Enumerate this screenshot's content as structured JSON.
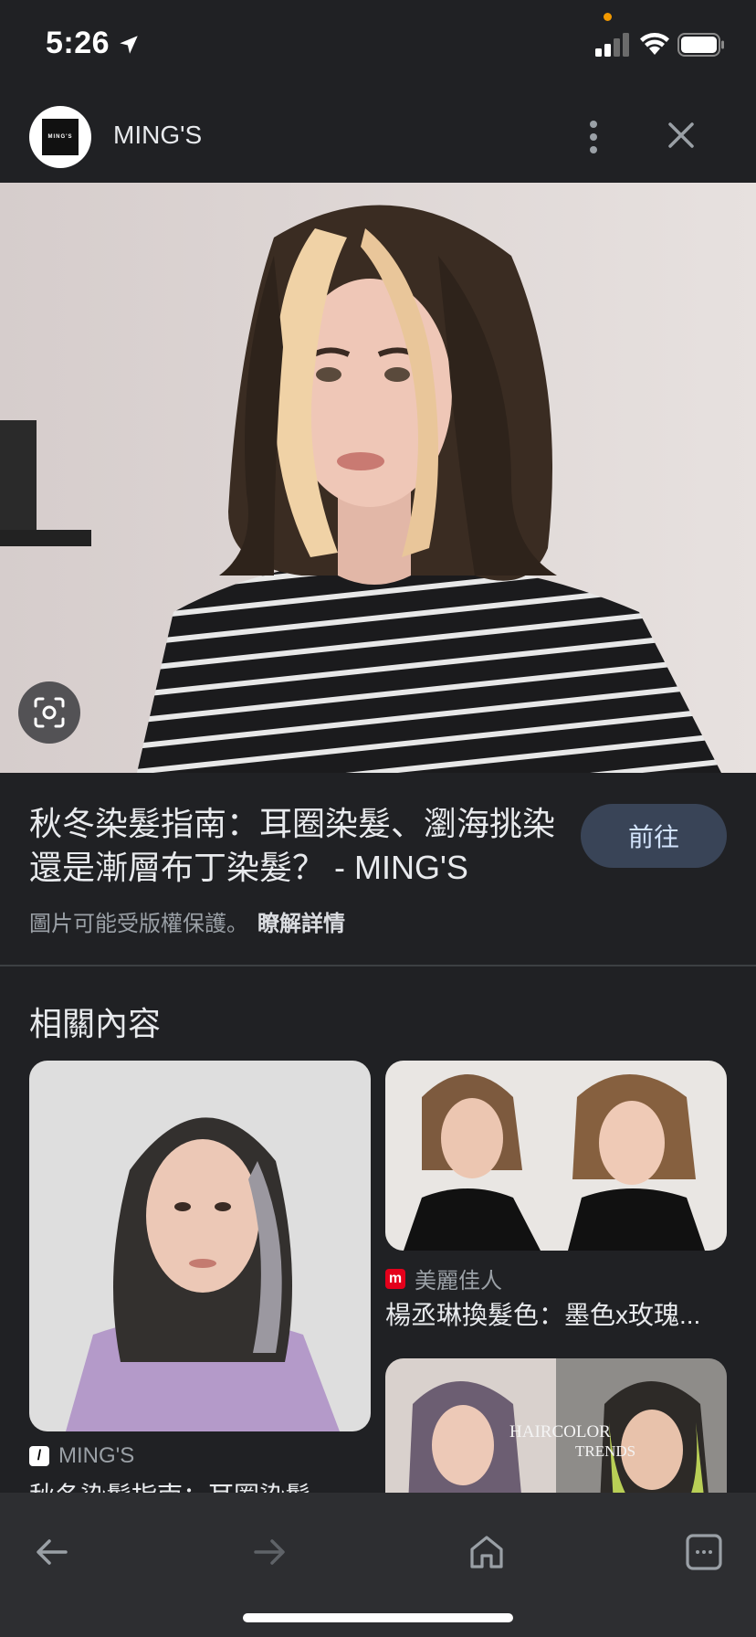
{
  "status_bar": {
    "time": "5:26"
  },
  "header": {
    "site_name": "MING'S",
    "logo_text": "MING'S"
  },
  "result": {
    "title": "秋冬染髮指南：耳圈染髮、瀏海挑染還是漸層布丁染髮？ - MING'S",
    "visit_label": "前往",
    "copyright_text": "圖片可能受版權保護。",
    "learn_more_label": "瞭解詳情"
  },
  "related": {
    "heading": "相關內容",
    "items": [
      {
        "source": "MING'S",
        "caption": "秋冬染髮指南：耳圈染髮"
      },
      {
        "source": "美麗佳人",
        "caption": "楊丞琳換髮色：墨色x玫瑰..."
      },
      {
        "image_text_1": "HAIRCOLOR",
        "image_text_2": "TRENDS"
      }
    ]
  },
  "icons": {
    "location": "location-arrow-icon",
    "more": "more-vert-icon",
    "close": "close-icon",
    "lens": "google-lens-icon",
    "back": "back-arrow-icon",
    "forward": "forward-arrow-icon",
    "home": "home-icon",
    "tabs": "tabs-icon"
  },
  "colors": {
    "background": "#202124",
    "button": "#394457",
    "toolbar": "#2d2e31"
  }
}
